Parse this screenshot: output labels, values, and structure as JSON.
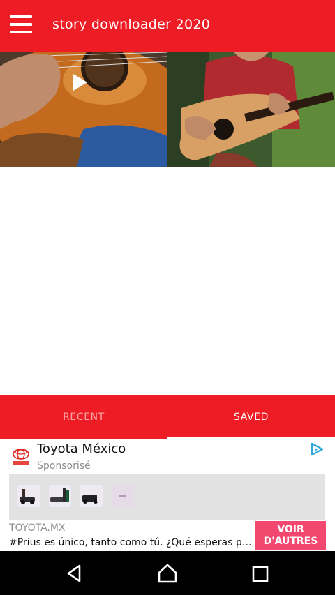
{
  "app_bar": {
    "title": "story downloader 2020",
    "menu_icon": "hamburger-menu-icon",
    "background": "#ee1c24"
  },
  "grid": {
    "items": [
      {
        "kind": "video",
        "icon": "play-icon"
      },
      {
        "kind": "image"
      }
    ]
  },
  "tabs": {
    "items": [
      {
        "label": "RECENT",
        "selected": false
      },
      {
        "label": "SAVED",
        "selected": true
      }
    ]
  },
  "ad": {
    "brand": "Toyota México",
    "sponsored": "Sponsorisé",
    "domain": "TOYOTA.MX",
    "text": "#Prius es único, tanto como tú. ¿Qué esperas para manejarlo?",
    "cta": "VOIR\nD'AUTRES",
    "cta_color": "#f2476e",
    "adchoices_icon": "adchoices-icon"
  },
  "nav_bar": {
    "back_icon": "back-triangle-icon",
    "home_icon": "home-icon",
    "recents_icon": "recents-square-icon"
  }
}
